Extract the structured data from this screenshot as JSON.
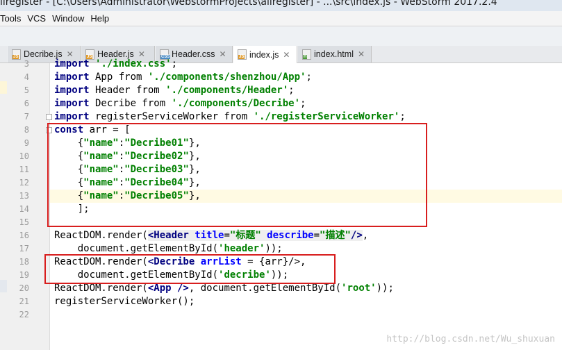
{
  "window": {
    "title": "llregister - [C:\\Users\\Administrator\\WebstormProjects\\allregister] - ...\\src\\index.js - WebStorm 2017.2.4"
  },
  "menubar": {
    "items": [
      "Tools",
      "VCS",
      "Window",
      "Help"
    ]
  },
  "tabs": [
    {
      "label": "Decribe.js",
      "icon": "js-file-icon",
      "badge": "JS",
      "active": false
    },
    {
      "label": "Header.js",
      "icon": "js-file-icon",
      "badge": "JS",
      "active": false
    },
    {
      "label": "Header.css",
      "icon": "css-file-icon",
      "badge": "CSS",
      "active": false
    },
    {
      "label": "index.js",
      "icon": "js-file-icon",
      "badge": "JS",
      "active": true
    },
    {
      "label": "index.html",
      "icon": "html-file-icon",
      "badge": "H",
      "active": false
    }
  ],
  "editor": {
    "line_numbers": [
      "3",
      "4",
      "5",
      "6",
      "7",
      "8",
      "9",
      "10",
      "11",
      "12",
      "13",
      "14",
      "15",
      "16",
      "17",
      "18",
      "19",
      "20",
      "21",
      "22"
    ],
    "lines": {
      "l3": {
        "kw": "import",
        "str": "'./index.css'",
        "rest": ";"
      },
      "l4": {
        "kw": "import",
        "name": " App from ",
        "str": "'./components/shenzhou/App'",
        "rest": ";"
      },
      "l5": {
        "kw": "import",
        "name": " Header from ",
        "str": "'./components/Header'",
        "rest": ";"
      },
      "l6": {
        "kw": "import",
        "name": " Decribe from ",
        "str": "'./components/Decribe'",
        "rest": ";"
      },
      "l7": {
        "kw": "import",
        "name": " registerServiceWorker from ",
        "str": "'./registerServiceWorker'",
        "rest": ";"
      },
      "l8": {
        "kw": "const",
        "rest": " arr = ["
      },
      "items": [
        {
          "key": "\"name\"",
          "value": "\"Decribe01\""
        },
        {
          "key": "\"name\"",
          "value": "\"Decribe02\""
        },
        {
          "key": "\"name\"",
          "value": "\"Decribe03\""
        },
        {
          "key": "\"name\"",
          "value": "\"Decribe04\""
        },
        {
          "key": "\"name\"",
          "value": "\"Decribe05\""
        }
      ],
      "l14": "    ];",
      "l16": {
        "pre": "ReactDOM.render(",
        "tag": "<Header",
        "attr1": " title",
        "eq1": "=",
        "val1": "\"标题\"",
        "attr2": " describe",
        "eq2": "=",
        "val2": "\"描述\"",
        "end": "/>",
        "rest": ","
      },
      "l17": {
        "pre": "    document.getElementById(",
        "str": "'header'",
        "rest": "));"
      },
      "l18": {
        "pre": "ReactDOM.render(",
        "tag": "<Decribe",
        "attr": " arrList",
        "rest": " = {arr}/>,"
      },
      "l19": {
        "pre": "    document.getElementById(",
        "str": "'decribe'",
        "rest": "));"
      },
      "l20": {
        "pre": "ReactDOM.render(",
        "tag": "<App",
        "end": " />",
        "mid": ", document.getElementById(",
        "str": "'root'",
        "rest": "));"
      },
      "l21": "registerServiceWorker();"
    }
  },
  "watermark": "http://blog.csdn.net/Wu_shuxuan"
}
